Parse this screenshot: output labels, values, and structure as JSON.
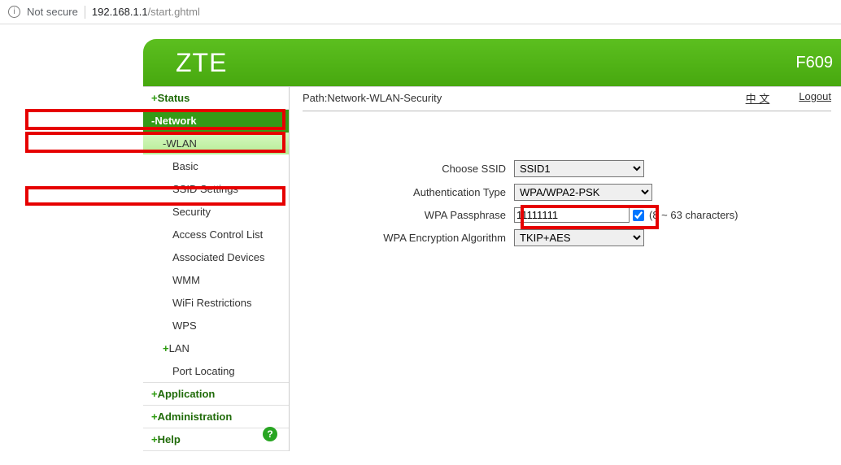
{
  "browser": {
    "secure_label": "Not secure",
    "url_host": "192.168.1.1",
    "url_path": "/start.ghtml"
  },
  "header": {
    "brand": "ZTE",
    "model": "F609"
  },
  "sidebar": {
    "status": "Status",
    "network": "Network",
    "wlan": "WLAN",
    "wlan_items": {
      "basic": "Basic",
      "ssid": "SSID Settings",
      "security": "Security",
      "acl": "Access Control List",
      "assoc": "Associated Devices",
      "wmm": "WMM",
      "wifi_restr": "WiFi Restrictions",
      "wps": "WPS"
    },
    "lan": "LAN",
    "port_locating": "Port Locating",
    "application": "Application",
    "administration": "Administration",
    "help": "Help"
  },
  "main": {
    "path": "Path:Network-WLAN-Security",
    "lang_link": "中 文",
    "logout": "Logout"
  },
  "form": {
    "choose_ssid_label": "Choose SSID",
    "choose_ssid_value": "SSID1",
    "auth_type_label": "Authentication Type",
    "auth_type_value": "WPA/WPA2-PSK",
    "wpa_pass_label": "WPA Passphrase",
    "wpa_pass_value": "11111111",
    "wpa_pass_hint": "(8 ~ 63 characters)",
    "wpa_enc_label": "WPA Encryption Algorithm",
    "wpa_enc_value": "TKIP+AES"
  }
}
